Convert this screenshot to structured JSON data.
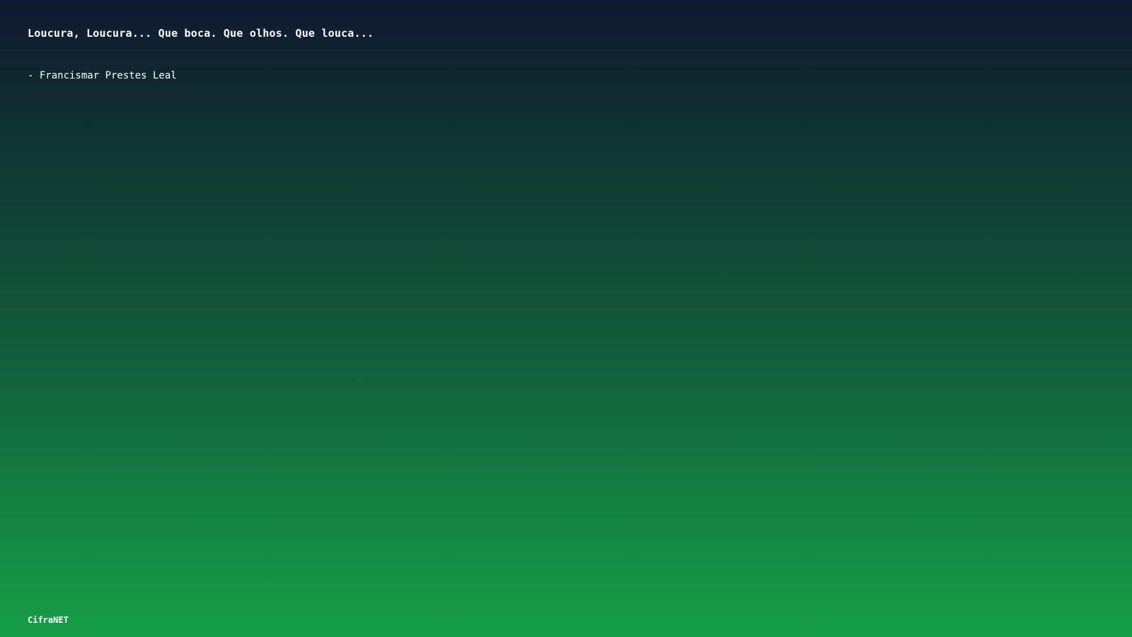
{
  "quote": {
    "text": "Loucura, Loucura... Que boca. Que olhos. Que louca...",
    "author": "- Francismar Prestes Leal"
  },
  "footer": {
    "brand": "CifraNET"
  },
  "colors": {
    "gradient_top": "#0f1830",
    "gradient_bottom": "#169e47",
    "text": "#ffffff"
  }
}
